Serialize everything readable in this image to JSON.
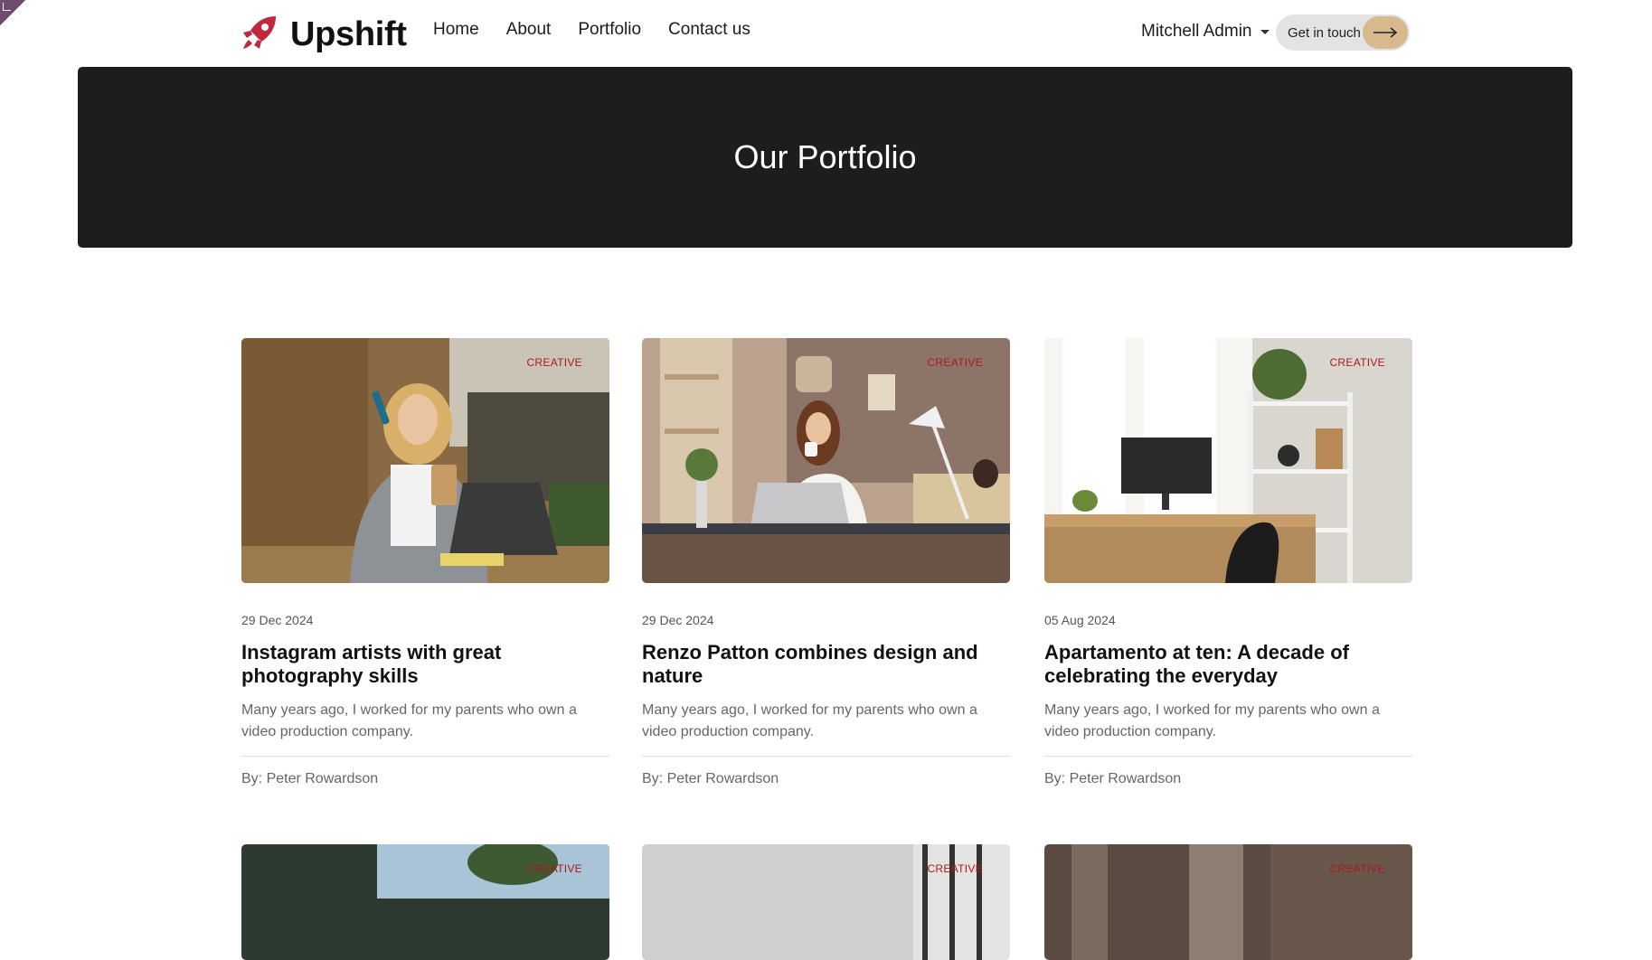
{
  "brand": {
    "name": "Upshift",
    "logo_icon": "rocket-icon",
    "color": "#c0283d"
  },
  "nav": {
    "items": [
      "Home",
      "About",
      "Portfolio",
      "Contact us"
    ]
  },
  "user_menu": {
    "label": "Mitchell Admin"
  },
  "cta": {
    "label": "Get in touch",
    "icon": "arrow-right-icon",
    "accent": "#d8b98e"
  },
  "hero": {
    "title": "Our Portfolio"
  },
  "posts": [
    {
      "tag": "CREATIVE",
      "date": "29 Dec 2024",
      "title": "Instagram artists with great photography skills",
      "excerpt": "Many years ago, I worked for my parents who own a video production company.",
      "author": "By: Peter Rowardson"
    },
    {
      "tag": "CREATIVE",
      "date": "29 Dec 2024",
      "title": "Renzo Patton combines design and nature",
      "excerpt": "Many years ago, I worked for my parents who own a video production company.",
      "author": "By: Peter Rowardson"
    },
    {
      "tag": "CREATIVE",
      "date": "05 Aug 2024",
      "title": "Apartamento at ten: A decade of celebrating the everyday",
      "excerpt": "Many years ago, I worked for my parents who own a video production company.",
      "author": "By: Peter Rowardson"
    }
  ],
  "more_posts": [
    {
      "tag": "CREATIVE"
    },
    {
      "tag": "CREATIVE"
    },
    {
      "tag": "CREATIVE"
    }
  ]
}
